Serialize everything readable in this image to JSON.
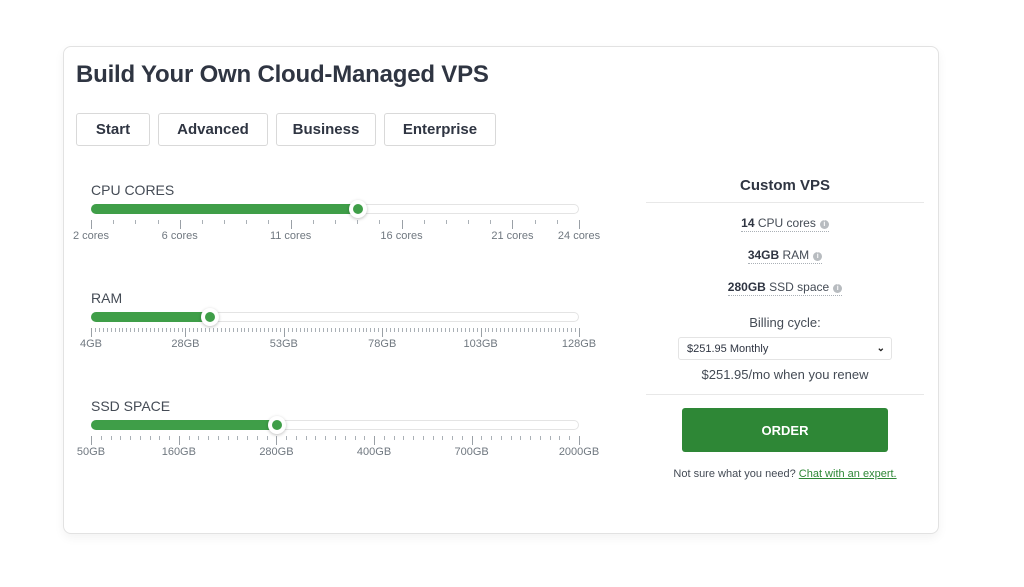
{
  "page": {
    "title": "Build Your Own Cloud-Managed VPS"
  },
  "plans": [
    {
      "label": "Start"
    },
    {
      "label": "Advanced"
    },
    {
      "label": "Business"
    },
    {
      "label": "Enterprise"
    }
  ],
  "sliders": [
    {
      "id": "cpu",
      "label": "CPU CORES",
      "min_index": 0,
      "max_index": 22,
      "value_index": 12,
      "value_display": "14 cores",
      "minor_ticks": 22,
      "major_tick_indices": [
        0,
        4,
        9,
        14,
        19,
        22
      ],
      "tick_labels": [
        {
          "index": 0,
          "label": "2 cores"
        },
        {
          "index": 4,
          "label": "6 cores"
        },
        {
          "index": 9,
          "label": "11 cores"
        },
        {
          "index": 14,
          "label": "16 cores"
        },
        {
          "index": 19,
          "label": "21 cores"
        },
        {
          "index": 22,
          "label": "24 cores"
        }
      ]
    },
    {
      "id": "ram",
      "label": "RAM",
      "min_index": 0,
      "max_index": 124,
      "value_index": 30,
      "value_display": "34GB",
      "minor_ticks": 124,
      "major_tick_indices": [
        0,
        24,
        49,
        74,
        99,
        124
      ],
      "tick_labels": [
        {
          "index": 0,
          "label": "4GB"
        },
        {
          "index": 24,
          "label": "28GB"
        },
        {
          "index": 49,
          "label": "53GB"
        },
        {
          "index": 74,
          "label": "78GB"
        },
        {
          "index": 99,
          "label": "103GB"
        },
        {
          "index": 124,
          "label": "128GB"
        }
      ]
    },
    {
      "id": "ssd",
      "label": "SSD SPACE",
      "min_index": 0,
      "max_index": 50,
      "value_index": 19,
      "value_display": "280GB",
      "minor_ticks": 50,
      "major_tick_indices": [
        0,
        9,
        19,
        29,
        39,
        50
      ],
      "tick_labels": [
        {
          "index": 0,
          "label": "50GB"
        },
        {
          "index": 9,
          "label": "160GB"
        },
        {
          "index": 19,
          "label": "280GB"
        },
        {
          "index": 29,
          "label": "400GB"
        },
        {
          "index": 39,
          "label": "700GB"
        },
        {
          "index": 50,
          "label": "2000GB"
        }
      ]
    }
  ],
  "summary": {
    "title": "Custom VPS",
    "specs": [
      {
        "value": "14",
        "unit": "CPU cores",
        "icon": "info-icon"
      },
      {
        "value": "34GB",
        "unit": "RAM",
        "icon": "info-icon"
      },
      {
        "value": "280GB",
        "unit": "SSD space",
        "icon": "info-icon"
      }
    ],
    "billing_label": "Billing cycle:",
    "billing_selected": "$251.95 Monthly",
    "renew_text": "$251.95/mo when you renew",
    "order_label": "ORDER",
    "help_text": "Not sure what you need?",
    "help_link": "Chat with an expert."
  },
  "colors": {
    "accent": "#3f9e48",
    "order_button": "#2e8736",
    "link": "#2e8736"
  }
}
